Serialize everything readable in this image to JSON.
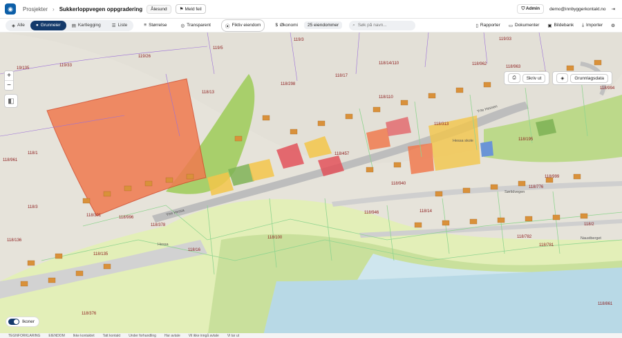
{
  "topbar": {
    "breadcrumb": "Prosjekter",
    "project": "Sukkerloppvegen oppgradering",
    "municipality": "Ålesund",
    "report_bug": "Meld feil",
    "role": "Admin",
    "user_email": "demo@innbyggerkontakt.no"
  },
  "toolbar": {
    "tabs": [
      {
        "label": "Alle"
      },
      {
        "label": "Grunneier"
      },
      {
        "label": "Kartlegging"
      },
      {
        "label": "Liste"
      }
    ],
    "size": "Størrelse",
    "transparent": "Transparent",
    "fictive": "Fiktiv eiendom",
    "economy": "Økonomi",
    "property_count": "25 eiendommer",
    "search_placeholder": "Søk på navn...",
    "reports": "Rapporter",
    "documents": "Dokumenter",
    "image_bank": "Bildebank",
    "import": "Importer"
  },
  "map": {
    "print": "Skriv ut",
    "base_data": "Grunnlagsdata",
    "icons_toggle": "Ikoner",
    "legend": [
      "TEGNFORKLARING",
      "EIENDOM",
      "Ikke kontaktet",
      "Tatt kontakt",
      "Under forhandling",
      "Har avtale",
      "Vil ikke inngå avtale",
      "Vi tar ut"
    ],
    "labels": [
      "19/135",
      "119/33",
      "119/26",
      "119/5",
      "119/3",
      "119/33",
      "118/963",
      "118/962",
      "118/14/110",
      "118/17",
      "118/298",
      "118/13",
      "118/110",
      "118/994",
      "118/961",
      "118/1",
      "118/999",
      "118/313",
      "118/195",
      "118/457",
      "118/940",
      "118/776",
      "118/946",
      "118/14",
      "118/3",
      "118/301",
      "118/376",
      "118/782",
      "118/781",
      "118/2",
      "118/100",
      "118/996",
      "118/378",
      "118/16",
      "118/136",
      "118/135",
      "118/861"
    ],
    "roads": [
      "Ytre Hessa",
      "Hessa skole",
      "Sørlidvegen",
      "Naustberget",
      "Yrte Hessen",
      "Hessa"
    ]
  },
  "colors": {
    "accent": "#143a6b",
    "orange": "#f07a4f",
    "green": "#7fb356",
    "yellow": "#f3c64a",
    "red": "#e2525a"
  }
}
